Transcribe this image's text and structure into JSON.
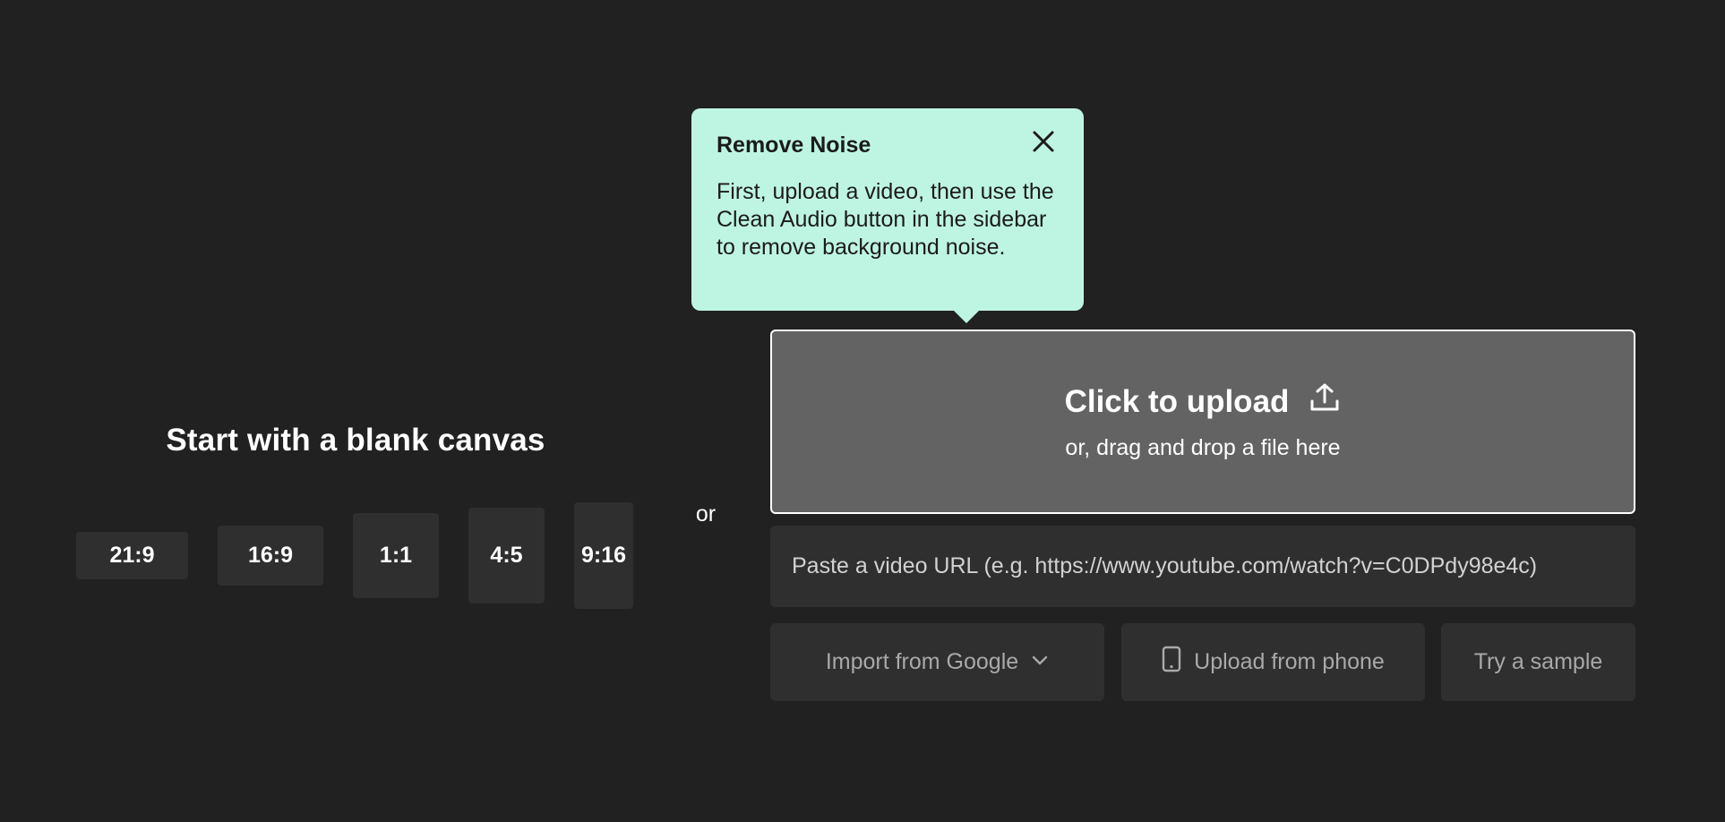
{
  "blank_canvas": {
    "title": "Start with a blank canvas",
    "ratios": [
      "21:9",
      "16:9",
      "1:1",
      "4:5",
      "9:16"
    ]
  },
  "or_label": "or",
  "tooltip": {
    "title": "Remove Noise",
    "body": "First, upload a video, then use the Clean Audio button in the sidebar to remove background noise.",
    "background_color": "#bef5e2"
  },
  "upload": {
    "title": "Click to upload",
    "subtitle": "or, drag and drop a file here",
    "icon": "upload-icon"
  },
  "url_input": {
    "placeholder": "Paste a video URL (e.g. https://www.youtube.com/watch?v=C0DPdy98e4c)",
    "value": ""
  },
  "actions": {
    "import_google": "Import from Google",
    "upload_phone": "Upload from phone",
    "try_sample": "Try a sample"
  },
  "colors": {
    "background": "#212121",
    "panel": "#2f2f2f",
    "upload_box": "#636363"
  }
}
